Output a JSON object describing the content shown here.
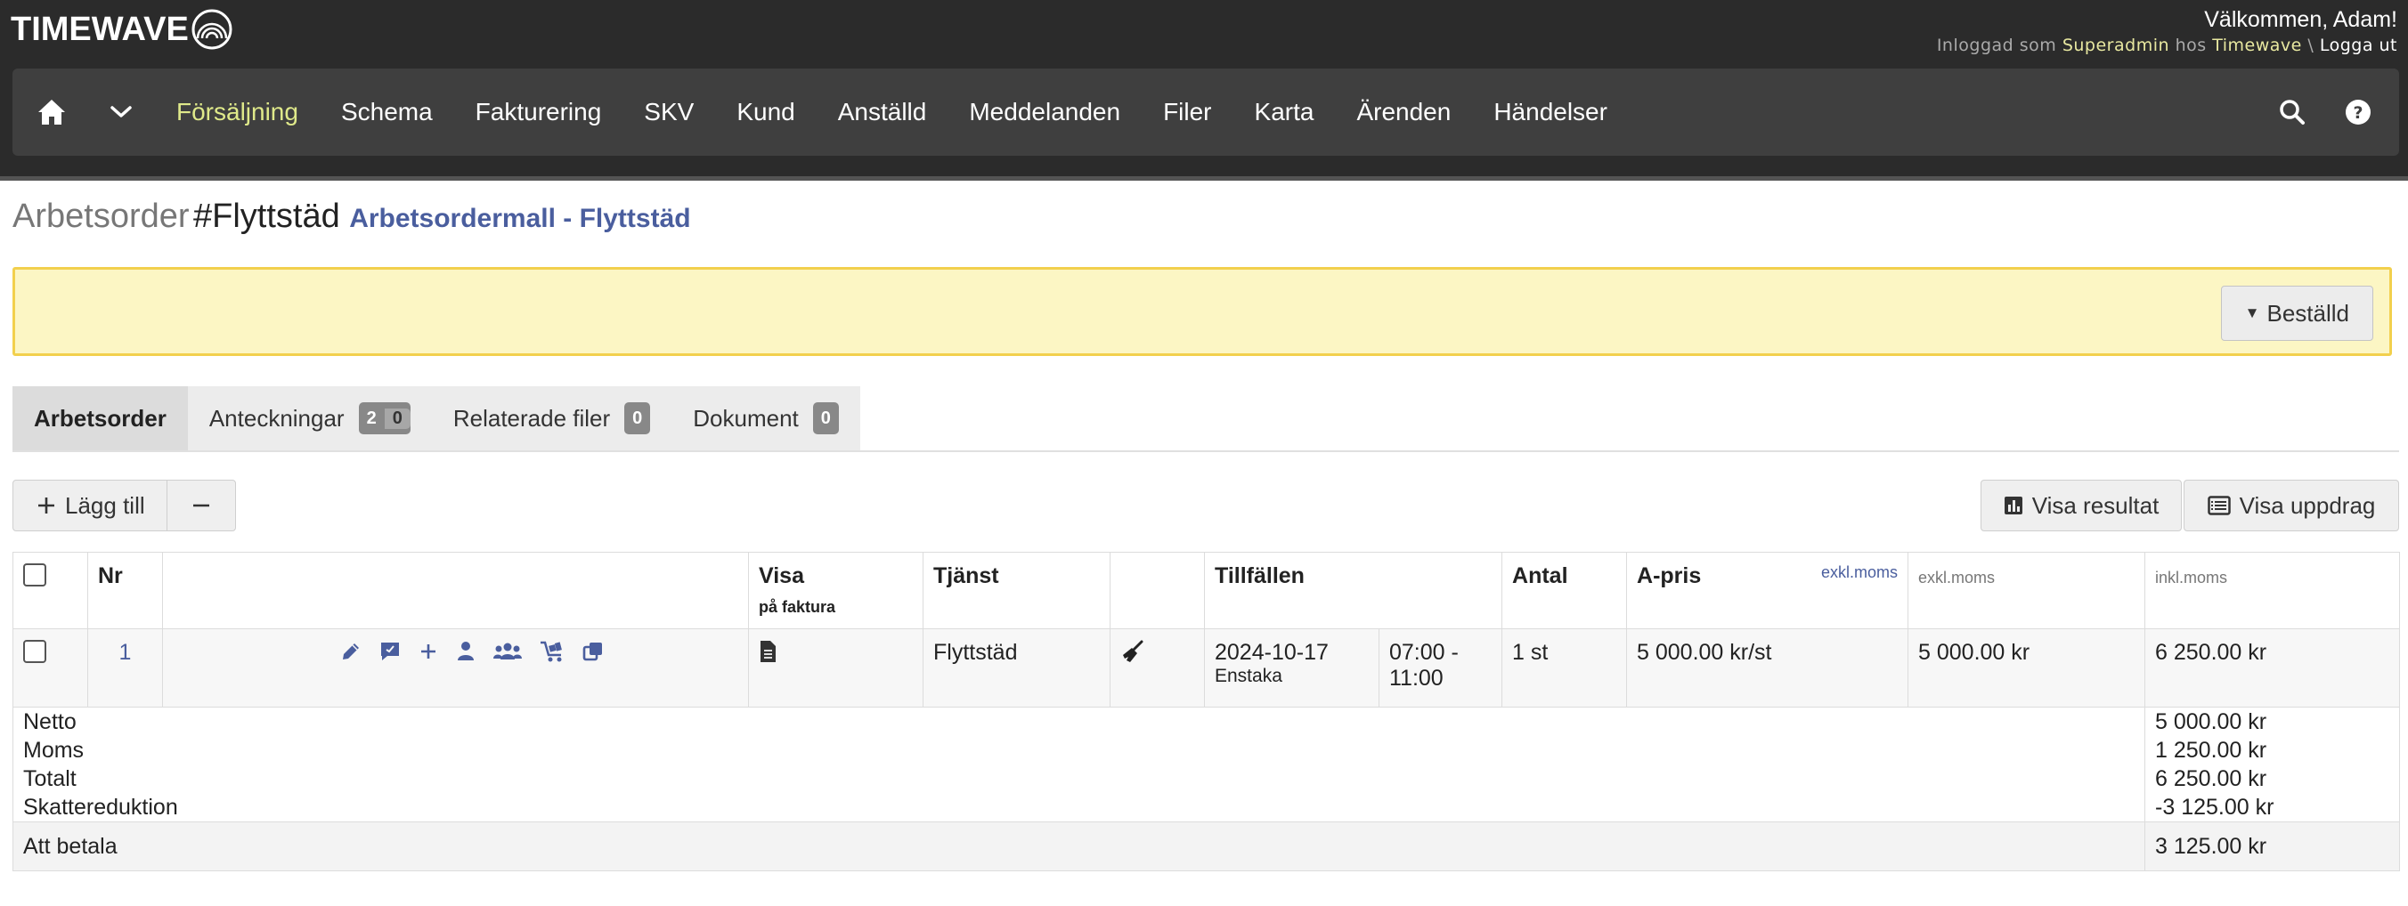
{
  "header": {
    "logo_text": "TIMEWAVE",
    "welcome": "Välkommen, Adam!",
    "login_prefix": "Inloggad som",
    "login_role": "Superadmin",
    "login_mid": "hos",
    "login_company": "Timewave",
    "login_sep": "\\",
    "logout": "Logga ut"
  },
  "nav": {
    "items": [
      "Försäljning",
      "Schema",
      "Fakturering",
      "SKV",
      "Kund",
      "Anställd",
      "Meddelanden",
      "Filer",
      "Karta",
      "Ärenden",
      "Händelser"
    ],
    "active_index": 0,
    "icons": [
      "home-icon",
      "chevron-down-icon",
      "search-icon",
      "help-icon"
    ]
  },
  "page": {
    "title_prefix": "Arbetsorder",
    "title_id": "#Flyttstäd",
    "template_link": "Arbetsordermall - Flyttstäd",
    "status_button": "Beställd"
  },
  "tabs": [
    {
      "label": "Arbetsorder"
    },
    {
      "label": "Anteckningar",
      "badge": "2",
      "badge2": "0"
    },
    {
      "label": "Relaterade filer",
      "badge": "0"
    },
    {
      "label": "Dokument",
      "badge": "0"
    }
  ],
  "toolbar": {
    "add": "Lägg till",
    "show_result": "Visa resultat",
    "show_jobs": "Visa uppdrag"
  },
  "table": {
    "headers": {
      "nr": "Nr",
      "visa": "Visa",
      "visa_sub": "på faktura",
      "tjanst": "Tjänst",
      "tillfallen": "Tillfällen",
      "antal": "Antal",
      "apris": "A-pris",
      "apris_link": "exkl.moms",
      "exkl": "exkl.moms",
      "inkl": "inkl.moms"
    },
    "rows": [
      {
        "nr": "1",
        "tjanst": "Flyttstäd",
        "date": "2024-10-17",
        "date_type": "Enstaka",
        "time": "07:00 - 11:00",
        "antal": "1 st",
        "apris": "5 000.00 kr/st",
        "exkl": "5 000.00 kr",
        "inkl": "6 250.00 kr"
      }
    ],
    "row_icons": [
      "edit-icon",
      "comment-icon",
      "plus-icon",
      "person-icon",
      "group-icon",
      "cart-icon",
      "copy-icon"
    ],
    "summary": {
      "netto_label": "Netto",
      "netto": "5 000.00 kr",
      "moms_label": "Moms",
      "moms": "1 250.00 kr",
      "total_label": "Totalt",
      "total": "6 250.00 kr",
      "skatt_label": "Skattereduktion",
      "skatt": "-3 125.00 kr",
      "pay_label": "Att betala",
      "pay": "3 125.00 kr"
    }
  },
  "colors": {
    "header_bg": "#2b2b2b",
    "nav_bg": "#3f3f3f",
    "nav_active": "#dfe98a",
    "link": "#4a5e9e",
    "banner_bg": "#fcf6c4",
    "banner_border": "#f2d04d"
  }
}
